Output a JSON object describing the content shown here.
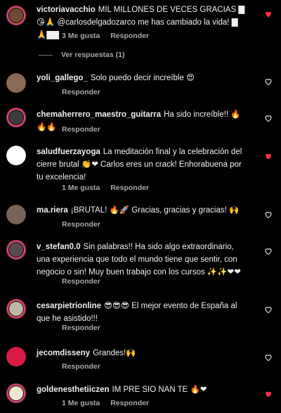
{
  "meta": {
    "likes": "3 Me gusta",
    "likes_one": "1 Me gusta",
    "reply": "Responder"
  },
  "view_replies": "Ver respuestas (1)",
  "comments": [
    {
      "user": "victoriavacchio",
      "text": "MIL MILLONES DE VECES GRACIAS ▇😘🙏 @carlosdelgadozarco me has cambiado la vida! ▇🙏▇▇",
      "likes": "3 Me gusta",
      "reply": "Responder",
      "liked": true
    },
    {
      "user": "yoli_gallego_",
      "text": "Solo puedo decir increíble 😍",
      "reply": "Responder",
      "liked": false
    },
    {
      "user": "chemaherrero_maestro_guitarra",
      "text": "Ha sido increíble!! 🔥🔥🔥",
      "reply": "Responder",
      "liked": false
    },
    {
      "user": "saludfuerzayoga",
      "text": "La meditación final y la celebración del cierre brutal 👏❤ Carlos eres un crack! Enhorabuena por tu excelencia!",
      "likes": "1 Me gusta",
      "reply": "Responder",
      "liked": true
    },
    {
      "user": "ma.riera",
      "text": "¡BRUTAL! 🔥🚀 Gracias, gracias y gracias! 🙌",
      "reply": "Responder",
      "liked": false
    },
    {
      "user": "v_stefan0.0",
      "text": "Sin palabras!! Ha sido algo extraordinario, una experiencia que todo el mundo tiene que sentir, con negocio o sin! Muy buen trabajo con los cursos ✨✨❤❤",
      "reply": "Responder",
      "liked": false
    },
    {
      "user": "cesarpietrionline",
      "text": "😎😎😎 El mejor evento de España al que he asistido!!!",
      "reply": "Responder",
      "liked": false
    },
    {
      "user": "jecomdisseny",
      "text": "Grandes!🙌",
      "reply": "Responder",
      "liked": false
    },
    {
      "user": "goldenesthetiiczen",
      "text": "IM PRE SIO NAN TE 🔥❤",
      "likes": "1 Me gusta",
      "reply": "Responder",
      "liked": true
    }
  ],
  "colors": {
    "like_red": "#ff3040",
    "meta_gray": "#a8a8a8",
    "avatar_ring": "#c13584"
  },
  "icons": [
    "heart-icon"
  ]
}
